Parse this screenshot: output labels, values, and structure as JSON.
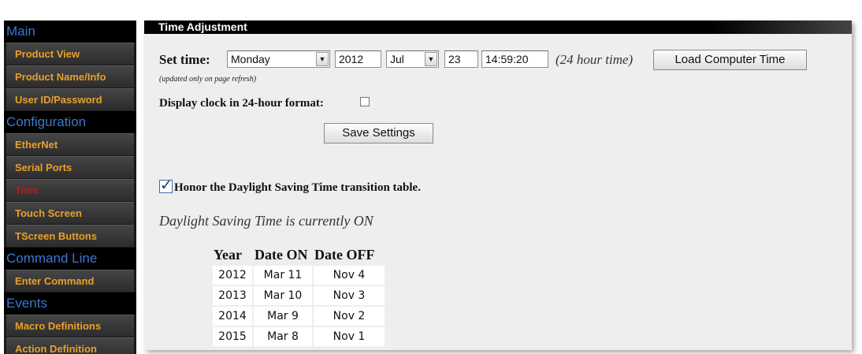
{
  "sidebar": {
    "sections": [
      {
        "title": "Main",
        "items": [
          "Product View",
          "Product Name/Info",
          "User ID/Password"
        ]
      },
      {
        "title": "Configuration",
        "items": [
          "EtherNet",
          "Serial Ports",
          "Time",
          "Touch Screen",
          "TScreen Buttons"
        ]
      },
      {
        "title": "Command Line",
        "items": [
          "Enter Command"
        ]
      },
      {
        "title": "Events",
        "items": [
          "Macro Definitions",
          "Action Definition"
        ]
      }
    ],
    "active_item": "Time"
  },
  "panel": {
    "title": "Time Adjustment",
    "set_time_label": "Set time:",
    "day_value": "Monday",
    "year_value": "2012",
    "month_value": "Jul",
    "date_value": "23",
    "time_value": "14:59:20",
    "hour_note": "(24 hour time)",
    "load_button": "Load Computer Time",
    "refresh_note": "(updated only on page refresh)",
    "clock_24_label": "Display clock in 24-hour format:",
    "clock_24_checked": false,
    "save_button": "Save Settings",
    "dst_honor_label": "Honor the Daylight Saving Time transition table.",
    "dst_honor_checked": true,
    "dst_status": "Daylight Saving Time is currently ON"
  },
  "dst_table": {
    "headers": [
      "Year",
      "Date ON",
      "Date OFF"
    ],
    "rows": [
      [
        "2012",
        "Mar 11",
        "Nov 4"
      ],
      [
        "2013",
        "Mar 10",
        "Nov 3"
      ],
      [
        "2014",
        "Mar 9",
        "Nov 2"
      ],
      [
        "2015",
        "Mar 8",
        "Nov 1"
      ]
    ]
  },
  "colors": {
    "sidebar_bg": "#1a1a1a",
    "section_title": "#3b78ce",
    "nav_item": "#e8a12a",
    "nav_item_active": "#c0161f",
    "panel_bg": "#eeeeee"
  }
}
